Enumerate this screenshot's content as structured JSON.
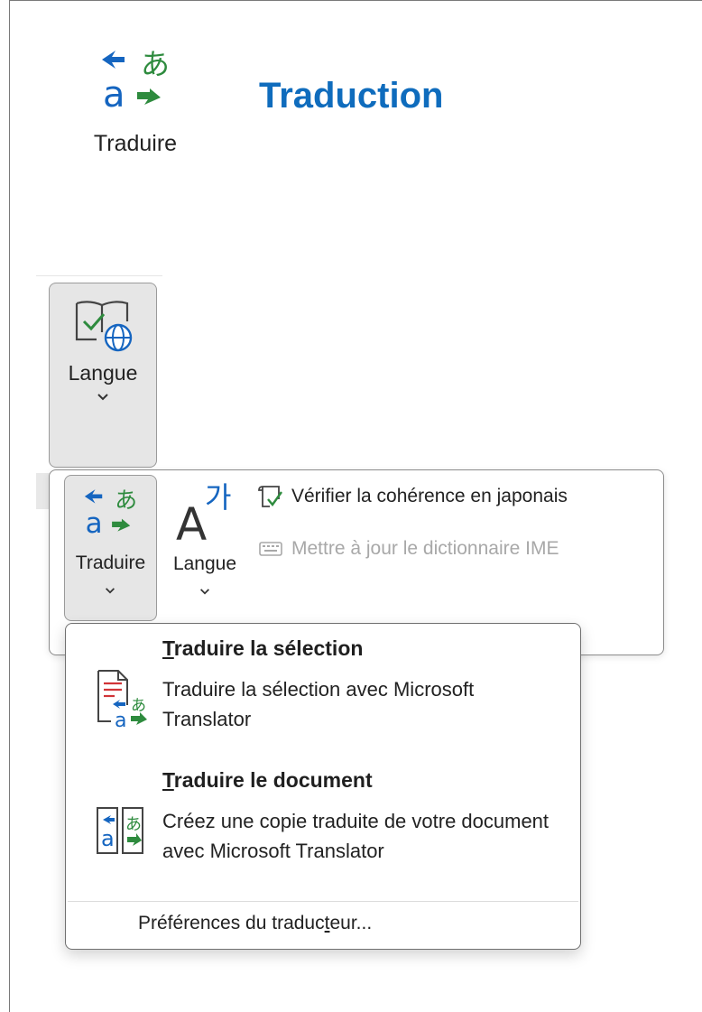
{
  "header": {
    "button_label": "Traduire",
    "title": "Traduction"
  },
  "ribbon": {
    "langue_group_button": "Langue",
    "translate_button": "Traduire",
    "language_button": "Langue",
    "check_japanese": "Vérifier la cohérence en japonais",
    "update_ime": "Mettre à jour le dictionnaire IME"
  },
  "menu": {
    "items": [
      {
        "title_accel": "T",
        "title_rest": "raduire la sélection",
        "description": "Traduire la sélection avec Microsoft Translator"
      },
      {
        "title_accel": "T",
        "title_rest": "raduire le document",
        "description": "Créez une copie traduite de votre document avec Microsoft Translator"
      }
    ],
    "preferences_pre": "Préférences du traduc",
    "preferences_accel": "t",
    "preferences_post": "eur..."
  },
  "colors": {
    "accent_blue": "#0f6cbd",
    "icon_blue": "#1565c0",
    "icon_green": "#2e8b3e",
    "pressed_bg": "#e6e6e6"
  },
  "icons": [
    "translate-icon",
    "language-check-globe-icon",
    "language-hangul-icon",
    "check-consistency-icon",
    "ime-dictionary-icon",
    "translate-selection-icon",
    "translate-document-icon",
    "chevron-down-icon"
  ]
}
